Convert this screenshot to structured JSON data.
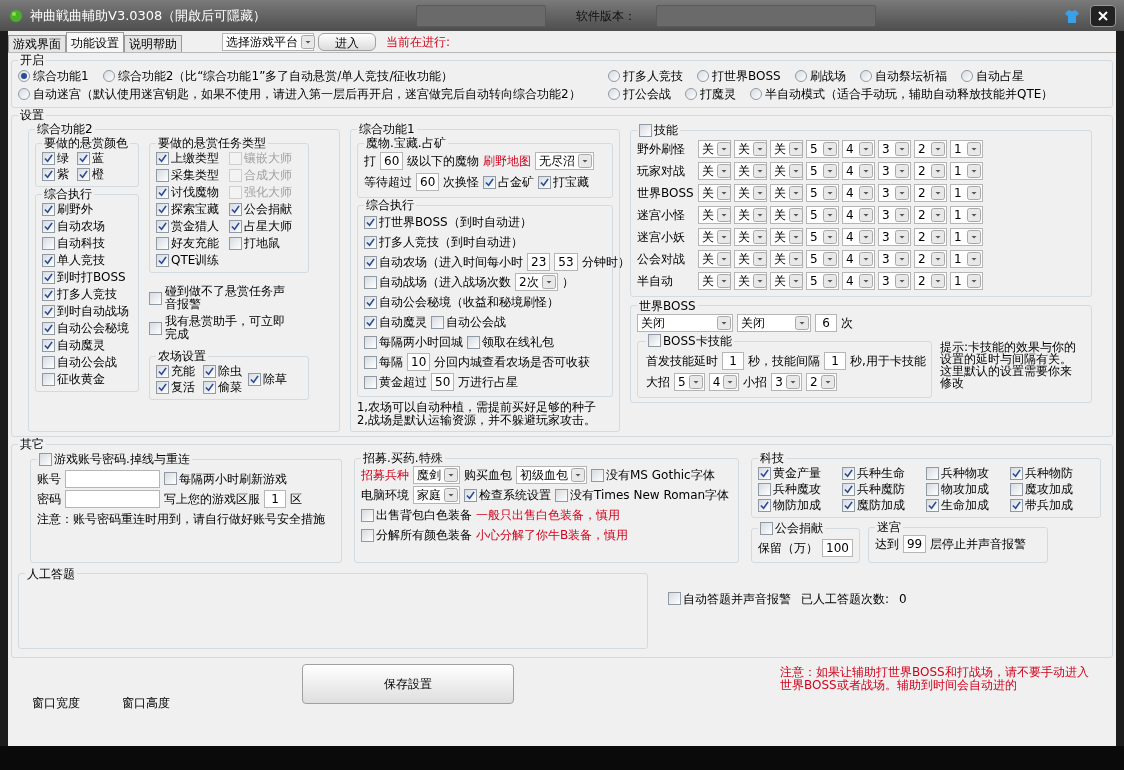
{
  "window": {
    "title": "神曲戦曲輔助V3.0308（開啟后可隱藏）",
    "version_label": "软件版本："
  },
  "tabs": [
    {
      "label": "游戏界面",
      "selected": false
    },
    {
      "label": "功能设置",
      "selected": true
    },
    {
      "label": "说明帮助",
      "selected": false
    }
  ],
  "toolbar": {
    "platform": "选择游戏平台",
    "enter": "进入",
    "status": "当前在进行:"
  },
  "start": {
    "title": "开启",
    "rows": [
      {
        "main": [
          {
            "label": "综合功能1",
            "selected": true
          },
          {
            "label": "综合功能2（比“综合功能1”多了自动悬赏/单人竞技/征收功能）",
            "selected": false
          }
        ],
        "extra": [
          {
            "label": "打多人竞技",
            "selected": false
          },
          {
            "label": "打世界BOSS",
            "selected": false
          },
          {
            "label": "刷战场",
            "selected": false
          },
          {
            "label": "自动祭坛祈福",
            "selected": false
          },
          {
            "label": "自动占星",
            "selected": false
          }
        ]
      },
      {
        "main": [
          {
            "label": "自动迷宫（默认使用迷宫钥匙，如果不使用，请进入第一层后再开启，迷宫做完后自动转向综合功能2）",
            "selected": false
          }
        ],
        "extra": [
          {
            "label": "打公会战",
            "selected": false
          },
          {
            "label": "打魔灵",
            "selected": false
          },
          {
            "label": "半自动模式（适合手动玩，辅助自动释放技能并QTE）",
            "selected": false
          }
        ]
      }
    ]
  },
  "settings": {
    "title": "设置",
    "combo2": {
      "title": "综合功能2",
      "colors": {
        "title": "要做的悬赏颜色",
        "items": [
          {
            "label": "绿",
            "checked": true
          },
          {
            "label": "蓝",
            "checked": true
          },
          {
            "label": "紫",
            "checked": true
          },
          {
            "label": "橙",
            "checked": true
          }
        ]
      },
      "exec": {
        "title": "综合执行",
        "items": [
          {
            "label": "刷野外",
            "checked": true
          },
          {
            "label": "自动农场",
            "checked": true
          },
          {
            "label": "自动科技",
            "checked": false
          },
          {
            "label": "单人竞技",
            "checked": true
          },
          {
            "label": "到时打BOSS",
            "checked": true
          },
          {
            "label": "打多人竞技",
            "checked": true
          },
          {
            "label": "到时自动战场",
            "checked": true
          },
          {
            "label": "自动公会秘境",
            "checked": true
          },
          {
            "label": "自动魔灵",
            "checked": true
          },
          {
            "label": "自动公会战",
            "checked": false
          },
          {
            "label": "征收黄金",
            "checked": false
          }
        ]
      },
      "tasks": {
        "title": "要做的悬赏任务类型",
        "items": [
          {
            "label": "上缴类型",
            "checked": true,
            "disabled": false
          },
          {
            "label": "镶嵌大师",
            "checked": false,
            "disabled": true
          },
          {
            "label": "采集类型",
            "checked": false,
            "disabled": false
          },
          {
            "label": "合成大师",
            "checked": false,
            "disabled": true
          },
          {
            "label": "讨伐魔物",
            "checked": true,
            "disabled": false
          },
          {
            "label": "强化大师",
            "checked": false,
            "disabled": true
          },
          {
            "label": "探索宝藏",
            "checked": true,
            "disabled": false
          },
          {
            "label": "公会捐献",
            "checked": true,
            "disabled": false
          },
          {
            "label": "赏金猎人",
            "checked": true,
            "disabled": false
          },
          {
            "label": "占星大师",
            "checked": true,
            "disabled": false
          },
          {
            "label": "好友充能",
            "checked": false,
            "disabled": false
          },
          {
            "label": "打地鼠",
            "checked": false,
            "disabled": false
          },
          {
            "label": "QTE训练",
            "checked": true,
            "disabled": false
          }
        ]
      },
      "alerts": [
        {
          "label": "碰到做不了悬赏任务声音报警",
          "checked": false
        },
        {
          "label": "我有悬赏助手，可立即完成",
          "checked": false
        }
      ],
      "farm": {
        "title": "农场设置",
        "items": [
          {
            "label": "充能",
            "checked": true
          },
          {
            "label": "除虫",
            "checked": true
          },
          {
            "label": "复活",
            "checked": true
          },
          {
            "label": "偷菜",
            "checked": true
          },
          {
            "label": "除草",
            "checked": true
          }
        ]
      }
    },
    "combo1": {
      "title": "综合功能1",
      "monsters": {
        "title": "魔物.宝藏.占矿",
        "lines": [
          {
            "parts": [
              {
                "kind": "text",
                "text": "打"
              },
              {
                "kind": "field",
                "value": "60"
              },
              {
                "kind": "text",
                "text": "级以下的魔物"
              },
              {
                "kind": "warn",
                "text": "刷野地图"
              },
              {
                "kind": "select",
                "value": "无尽沼"
              }
            ]
          },
          {
            "parts": [
              {
                "kind": "text",
                "text": "等待超过"
              },
              {
                "kind": "field",
                "value": "60"
              },
              {
                "kind": "text",
                "text": "次换怪"
              },
              {
                "kind": "check",
                "label": "占金矿",
                "checked": true
              },
              {
                "kind": "check",
                "label": "打宝藏",
                "checked": true
              }
            ]
          }
        ]
      },
      "exec": {
        "title": "综合执行",
        "lines": [
          {
            "parts": [
              {
                "kind": "check",
                "label": "打世界BOSS（到时自动进）",
                "checked": true
              }
            ]
          },
          {
            "parts": [
              {
                "kind": "check",
                "label": "打多人竞技（到时自动进）",
                "checked": true
              }
            ]
          },
          {
            "parts": [
              {
                "kind": "check",
                "label": "自动农场（进入时间每小时",
                "checked": true
              },
              {
                "kind": "field",
                "value": "23"
              },
              {
                "kind": "field",
                "value": "53"
              },
              {
                "kind": "text",
                "text": "分钟时）"
              }
            ]
          },
          {
            "parts": [
              {
                "kind": "check",
                "label": "自动战场（进入战场次数",
                "checked": false
              },
              {
                "kind": "select",
                "value": "2次"
              },
              {
                "kind": "text",
                "text": "）"
              }
            ]
          },
          {
            "parts": [
              {
                "kind": "check",
                "label": "自动公会秘境（收益和秘境刷怪）",
                "checked": true
              }
            ]
          },
          {
            "parts": [
              {
                "kind": "check",
                "label": "自动魔灵",
                "checked": true
              },
              {
                "kind": "check",
                "label": "自动公会战",
                "checked": false
              }
            ]
          },
          {
            "parts": [
              {
                "kind": "check",
                "label": "每隔两小时回城",
                "checked": false
              },
              {
                "kind": "check",
                "label": "领取在线礼包",
                "checked": false
              }
            ]
          },
          {
            "parts": [
              {
                "kind": "check",
                "label": "每隔",
                "checked": false
              },
              {
                "kind": "field",
                "value": "10"
              },
              {
                "kind": "text",
                "text": "分回内城查看农场是否可收获"
              }
            ]
          },
          {
            "parts": [
              {
                "kind": "check",
                "label": "黄金超过",
                "checked": false
              },
              {
                "kind": "field",
                "value": "50"
              },
              {
                "kind": "text",
                "text": "万进行占星"
              }
            ]
          }
        ]
      },
      "notes": [
        "1,农场可以自动种植，需提前买好足够的种子",
        "2,战场是默认运输资源，并不躲避玩家攻击。"
      ]
    },
    "skills": {
      "label": "技能",
      "checked": false,
      "rows": [
        {
          "label": "野外刷怪",
          "slots": [
            "关",
            "关",
            "关",
            "5",
            "4",
            "3",
            "2",
            "1"
          ]
        },
        {
          "label": "玩家对战",
          "slots": [
            "关",
            "关",
            "关",
            "5",
            "4",
            "3",
            "2",
            "1"
          ]
        },
        {
          "label": "世界BOSS",
          "slots": [
            "关",
            "关",
            "关",
            "5",
            "4",
            "3",
            "2",
            "1"
          ]
        },
        {
          "label": "迷宫小怪",
          "slots": [
            "关",
            "关",
            "关",
            "5",
            "4",
            "3",
            "2",
            "1"
          ]
        },
        {
          "label": "迷宫小妖",
          "slots": [
            "关",
            "关",
            "关",
            "5",
            "4",
            "3",
            "2",
            "1"
          ]
        },
        {
          "label": "公会对战",
          "slots": [
            "关",
            "关",
            "关",
            "5",
            "4",
            "3",
            "2",
            "1"
          ]
        },
        {
          "label": "半自动",
          "slots": [
            "关",
            "关",
            "关",
            "5",
            "4",
            "3",
            "2",
            "1"
          ]
        }
      ]
    },
    "world_boss": {
      "title": "世界BOSS",
      "line": {
        "parts": [
          {
            "kind": "wide_select",
            "value": "关闭"
          },
          {
            "kind": "mid_select",
            "value": "关闭"
          },
          {
            "kind": "field",
            "value": "6"
          },
          {
            "kind": "text",
            "text": "次"
          }
        ]
      },
      "card": {
        "label": "BOSS卡技能",
        "checked": false,
        "lines": [
          {
            "parts": [
              {
                "kind": "text",
                "text": "首发技能延时"
              },
              {
                "kind": "field",
                "value": "1"
              },
              {
                "kind": "text",
                "text": "秒，技能间隔"
              },
              {
                "kind": "field",
                "value": "1"
              },
              {
                "kind": "text",
                "text": "秒,用于卡技能"
              }
            ]
          },
          {
            "parts": [
              {
                "kind": "text",
                "text": "大招"
              },
              {
                "kind": "select",
                "value": "5"
              },
              {
                "kind": "select",
                "value": "4"
              },
              {
                "kind": "text",
                "text": "小招"
              },
              {
                "kind": "select",
                "value": "3"
              },
              {
                "kind": "select",
                "value": "2"
              }
            ]
          }
        ]
      },
      "hint": "提示:卡技能的效果与你的设置的延时与间隔有关。这里默认的设置需要你来修改"
    }
  },
  "other": {
    "title": "其它",
    "account": {
      "label": "游戏账号密码.掉线与重连",
      "checked": false,
      "lines": [
        {
          "parts": [
            {
              "kind": "text",
              "text": "账号"
            },
            {
              "kind": "long_field"
            },
            {
              "kind": "check",
              "label": "每隔两小时刷新游戏",
              "checked": false
            }
          ]
        },
        {
          "parts": [
            {
              "kind": "text",
              "text": "密码"
            },
            {
              "kind": "long_field"
            },
            {
              "kind": "text",
              "text": "写上您的游戏区服"
            },
            {
              "kind": "field",
              "value": "1"
            },
            {
              "kind": "text",
              "text": "区"
            }
          ]
        },
        {
          "parts": [
            {
              "kind": "text",
              "text": "注意：账号密码重连时用到，请自行做好账号安全措施"
            }
          ]
        }
      ]
    },
    "recruit": {
      "title": "招募.买药.特殊",
      "lines": [
        {
          "parts": [
            {
              "kind": "warn",
              "text": "招募兵种"
            },
            {
              "kind": "select",
              "value": "魔剑"
            },
            {
              "kind": "text",
              "text": "购买血包"
            },
            {
              "kind": "select",
              "value": "初级血包"
            },
            {
              "kind": "check",
              "label": "没有MS Gothic字体",
              "checked": false
            }
          ]
        },
        {
          "parts": [
            {
              "kind": "text",
              "text": "电脑环境"
            },
            {
              "kind": "select",
              "value": "家庭"
            },
            {
              "kind": "check",
              "label": "检查系统设置",
              "checked": true
            },
            {
              "kind": "check",
              "label": "没有Times New Roman字体",
              "checked": false
            }
          ]
        },
        {
          "parts": [
            {
              "kind": "check",
              "label": "出售背包白色装备",
              "checked": false
            },
            {
              "kind": "warn",
              "text": "一般只出售白色装备，慎用"
            }
          ]
        },
        {
          "parts": [
            {
              "kind": "check",
              "label": "分解所有颜色装备",
              "checked": false
            },
            {
              "kind": "warn",
              "text": "小心分解了你牛B装备，慎用"
            }
          ]
        }
      ]
    },
    "tech": {
      "title": "科技",
      "items": [
        {
          "label": "黄金产量",
          "checked": true
        },
        {
          "label": "兵种生命",
          "checked": true
        },
        {
          "label": "兵种物攻",
          "checked": false
        },
        {
          "label": "兵种物防",
          "checked": true
        },
        {
          "label": "兵种魔攻",
          "checked": false
        },
        {
          "label": "兵种魔防",
          "checked": true
        },
        {
          "label": "物攻加成",
          "checked": false
        },
        {
          "label": "魔攻加成",
          "checked": false
        },
        {
          "label": "物防加成",
          "checked": true
        },
        {
          "label": "魔防加成",
          "checked": true
        },
        {
          "label": "生命加成",
          "checked": true
        },
        {
          "label": "带兵加成",
          "checked": true
        }
      ]
    },
    "donate": {
      "label": "公会捐献",
      "checked": false,
      "line": {
        "parts": [
          {
            "kind": "text",
            "text": "保留（万）"
          },
          {
            "kind": "field",
            "value": "100"
          }
        ]
      }
    },
    "maze": {
      "title": "迷宫",
      "line": {
        "parts": [
          {
            "kind": "text",
            "text": "达到"
          },
          {
            "kind": "field",
            "value": "99"
          },
          {
            "kind": "text",
            "text": "层停止并声音报警"
          }
        ]
      }
    },
    "answers": {
      "title": "人工答题",
      "line": {
        "parts": [
          {
            "kind": "check",
            "label": "自动答题并声音报警",
            "checked": false
          },
          {
            "kind": "text",
            "text": "已人工答题次数:"
          },
          {
            "kind": "text",
            "text": "0"
          }
        ]
      }
    }
  },
  "footer": {
    "width_label": "窗口宽度",
    "height_label": "窗口高度",
    "save": "保存設置",
    "note": "注意：如果让辅助打世界BOSS和打战场，请不要手动进入世界BOSS或者战场。辅助到时间会自动进的"
  }
}
